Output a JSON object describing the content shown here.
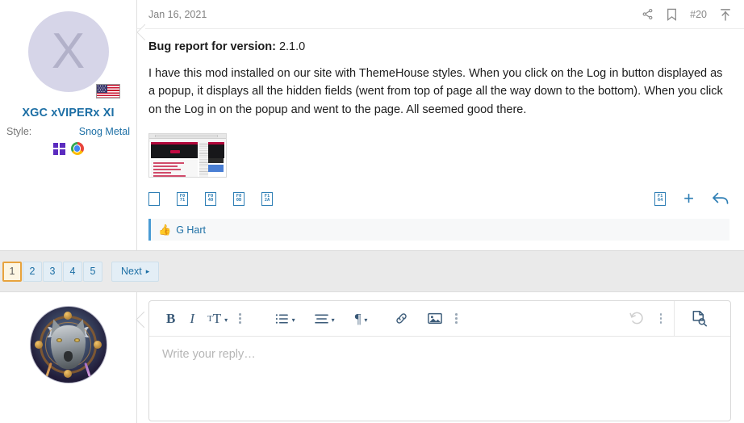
{
  "post": {
    "user": {
      "avatar_letter": "X",
      "avatar_name": "avatar-initial-x",
      "flag": "us-flag-badge",
      "username": "XGC xVIPERx XI",
      "style_label": "Style:",
      "style_value": "Snog Metal",
      "os_icons": [
        "windows-icon",
        "chrome-icon"
      ]
    },
    "header": {
      "date": "Jan 16, 2021",
      "share_icon": "share-icon",
      "bookmark_icon": "bookmark-icon",
      "post_number": "#20",
      "jump_icon": "jump-to-top-icon"
    },
    "content": {
      "bug_label": "Bug report for version:",
      "bug_version": "2.1.0",
      "body": "I have this mod installed on our site with ThemeHouse styles. When you click on the Log in button displayed as a popup, it displays all the hidden fields (went from top of page all the way down to the bottom). When you click on the Log in on the popup and went to the page. All seemed good there.",
      "attachment_alt": "forum-screenshot-thumbnail"
    },
    "actions": {
      "left": [
        {
          "name": "checkbox-icon",
          "code": ""
        },
        {
          "name": "warning-icon",
          "code": "F071"
        },
        {
          "name": "at-mention-icon",
          "code": "F040"
        },
        {
          "name": "times-icon",
          "code": "F00D"
        },
        {
          "name": "comments-icon",
          "code": "F12A"
        }
      ],
      "right": [
        {
          "name": "like-icon",
          "code": "F164"
        },
        {
          "name": "plus-icon",
          "code": "+"
        },
        {
          "name": "reply-icon",
          "code": "reply-arrow"
        }
      ]
    },
    "reaction": {
      "emoji": "thumbs-up-emoji",
      "names": "G Hart"
    }
  },
  "pagination": {
    "pages": [
      "1",
      "2",
      "3",
      "4",
      "5"
    ],
    "active": "1",
    "next_label": "Next",
    "next_caret": "▸",
    "active_border_color": "#e8a33d",
    "link_color": "#1d6fa5"
  },
  "composer": {
    "avatar_name": "wolf-dreamcatcher-avatar",
    "toolbar": {
      "bold": "B",
      "italic": "I",
      "font_size": "T",
      "font_size_small": "T",
      "more_1": "more-text-options-icon",
      "list": "unordered-list-icon",
      "align": "text-align-icon",
      "paragraph": "¶",
      "more_2": "more-insert-options-icon",
      "link": "link-icon",
      "image": "image-icon",
      "undo": "undo-icon",
      "preview": "preview-icon"
    },
    "placeholder": "Write your reply…"
  },
  "colors": {
    "link": "#1d6fa5",
    "icon_blue": "#2f7fb5",
    "band_bg": "#eaeaea",
    "toolbar_icon": "#3a5a78",
    "placeholder": "#b6b6b6"
  }
}
